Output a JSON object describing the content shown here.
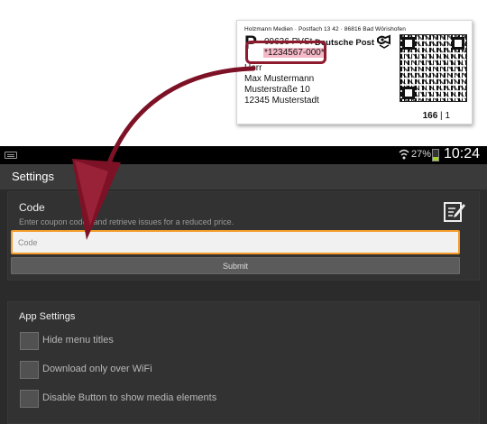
{
  "label": {
    "sender": "Holzmann Medien · Postfach 13 42 · 86816 Bad Wörishofen",
    "p_logo": "P",
    "pvst": "09636 PVSt",
    "carrier": "Deutsche Post",
    "coupon_code": "*1234567-000*",
    "recipient": [
      "Herr",
      "Max Mustermann",
      "Musterstraße 10",
      "12345 Musterstadt"
    ],
    "page_main": "166",
    "page_sep": " | ",
    "page_sub": "1"
  },
  "status_bar": {
    "battery": "27%",
    "time": "10:24"
  },
  "action_bar": {
    "title": "Settings"
  },
  "code_section": {
    "title": "Code",
    "description": "Enter coupon codes and retrieve issues for a reduced price.",
    "input_placeholder": "Code",
    "submit_label": "Submit"
  },
  "app_settings": {
    "title": "App Settings",
    "options": [
      {
        "label": "Hide menu titles",
        "checked": false
      },
      {
        "label": "Download only over WiFi",
        "checked": false
      },
      {
        "label": "Disable Button to show media elements",
        "checked": false
      }
    ]
  },
  "colors": {
    "highlight_border": "#8e1a2e",
    "code_highlight": "#f5b8c6",
    "input_focus": "#f39a28",
    "app_background": "#2b2b2b"
  }
}
